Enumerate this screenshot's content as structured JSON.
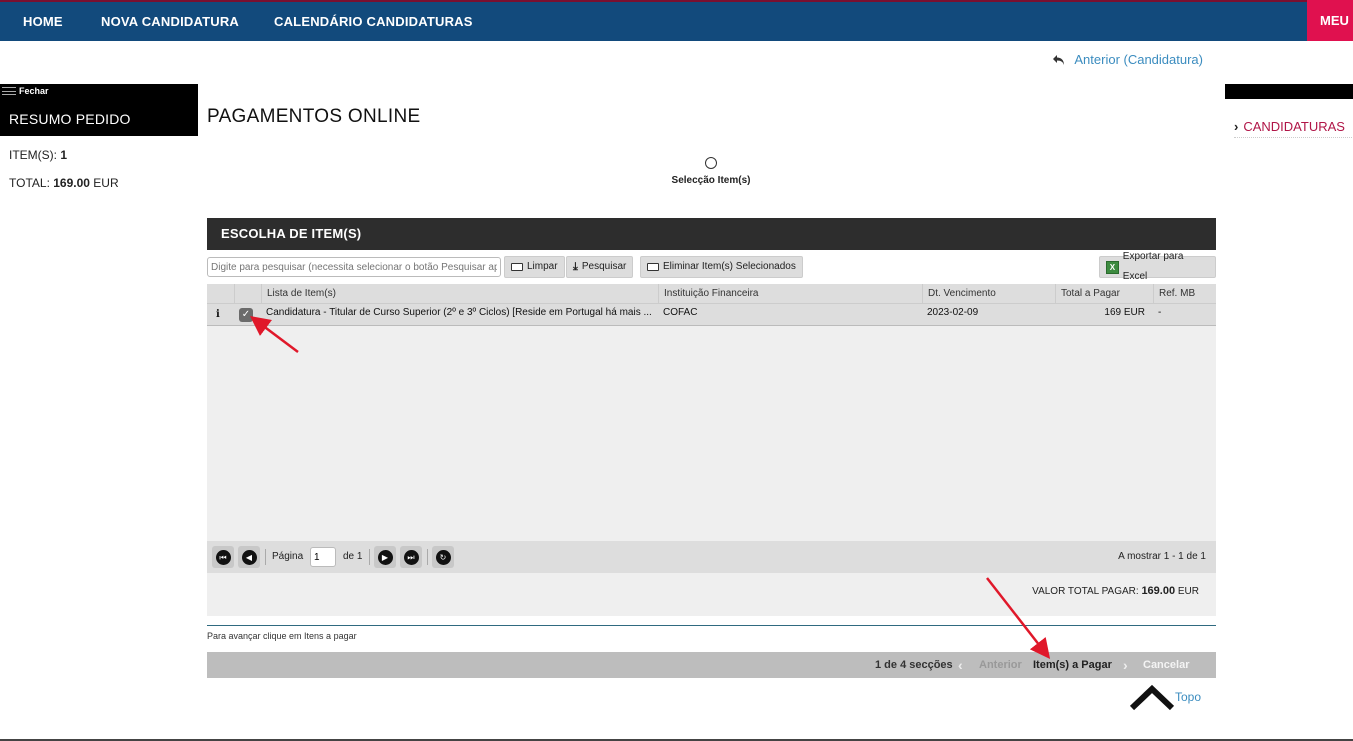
{
  "nav": {
    "items": [
      "HOME",
      "NOVA CANDIDATURA",
      "CALENDÁRIO CANDIDATURAS"
    ],
    "meu": "MEU"
  },
  "back_link": "Anterior (Candidatura)",
  "left": {
    "close": "Fechar",
    "title": "RESUMO PEDIDO",
    "items_label": "ITEM(S):",
    "items_value": "1",
    "total_label": "TOTAL:",
    "total_value": "169.00",
    "total_currency": "EUR"
  },
  "right": {
    "link": "CANDIDATURAS"
  },
  "page_title": "PAGAMENTOS ONLINE",
  "step_label": "Selecção Item(s)",
  "panel": {
    "title": "ESCOLHA DE ITEM(S)",
    "search_placeholder": "Digite para pesquisar (necessita selecionar o botão Pesquisar após",
    "btn_clear": "Limpar",
    "btn_search": "Pesquisar",
    "btn_delete": "Eliminar Item(s) Selecionados",
    "btn_excel": "Exportar para Excel",
    "columns": [
      "Lista de Item(s)",
      "Instituição Financeira",
      "Dt. Vencimento",
      "Total a Pagar",
      "Ref. MB"
    ],
    "row": {
      "info": "i",
      "item": "Candidatura - Titular de Curso Superior (2º e 3º Ciclos) [Reside em Portugal há mais ...",
      "institution": "COFAC",
      "due_date": "2023-02-09",
      "total": "169 EUR",
      "ref_mb": "-"
    },
    "pager": {
      "page_label": "Página",
      "page_value": "1",
      "of_label": "de 1",
      "showing": "A mostrar 1 - 1 de 1"
    },
    "total_label": "VALOR TOTAL PAGAR:",
    "total_value": "169.00",
    "total_currency": "EUR"
  },
  "hint": "Para avançar clique em Itens a pagar",
  "section_nav": {
    "sections": "1 de 4 secções",
    "prev": "Anterior",
    "next": "Item(s) a Pagar",
    "cancel": "Cancelar"
  },
  "topo": "Topo",
  "colors": {
    "nav_bg": "#124a7c",
    "meu_bg": "#e0114f",
    "link": "#3b8cbf",
    "annotation": "#e0182a"
  }
}
